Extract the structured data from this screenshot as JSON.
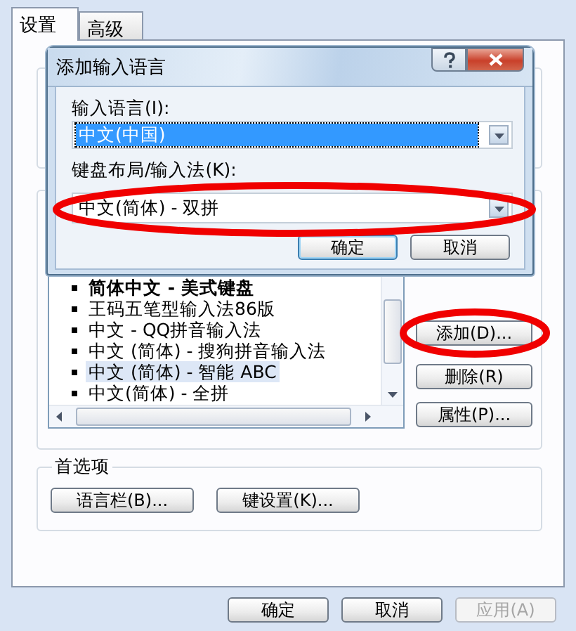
{
  "tabs": [
    {
      "label": "设置",
      "selected": true
    },
    {
      "label": "高级",
      "selected": false
    }
  ],
  "input_languages": {
    "items": [
      {
        "label": "简体中文 - 美式键盘",
        "default": true,
        "selected": false
      },
      {
        "label": "王码五笔型输入法86版",
        "default": false,
        "selected": false
      },
      {
        "label": "中文 - QQ拼音输入法",
        "default": false,
        "selected": false
      },
      {
        "label": "中文 (简体) - 搜狗拼音输入法",
        "default": false,
        "selected": false
      },
      {
        "label": "中文 (简体) - 智能 ABC",
        "default": false,
        "selected": true
      },
      {
        "label": "中文(简体) - 全拼",
        "default": false,
        "selected": false
      }
    ],
    "buttons": [
      {
        "label": "添加(D)...",
        "circled": true
      },
      {
        "label": "删除(R)",
        "circled": false
      },
      {
        "label": "属性(P)...",
        "circled": false
      }
    ]
  },
  "preferences": {
    "title": "首选项",
    "buttons": [
      {
        "label": "语言栏(B)..."
      },
      {
        "label": "键设置(K)..."
      }
    ]
  },
  "buttons": [
    {
      "label": "确定",
      "disabled": false
    },
    {
      "label": "取消",
      "disabled": false
    },
    {
      "label": "应用(A)",
      "disabled": true
    }
  ],
  "dialog": {
    "title": "添加输入语言",
    "language_label": "输入语言(I):",
    "language": "中文(中国)",
    "language_selected": true,
    "layout_label": "键盘布局/输入法(K):",
    "layout": "中文(简体) - 双拼",
    "layout_circled": true,
    "buttons": [
      {
        "label": "确定"
      },
      {
        "label": "取消"
      }
    ]
  }
}
